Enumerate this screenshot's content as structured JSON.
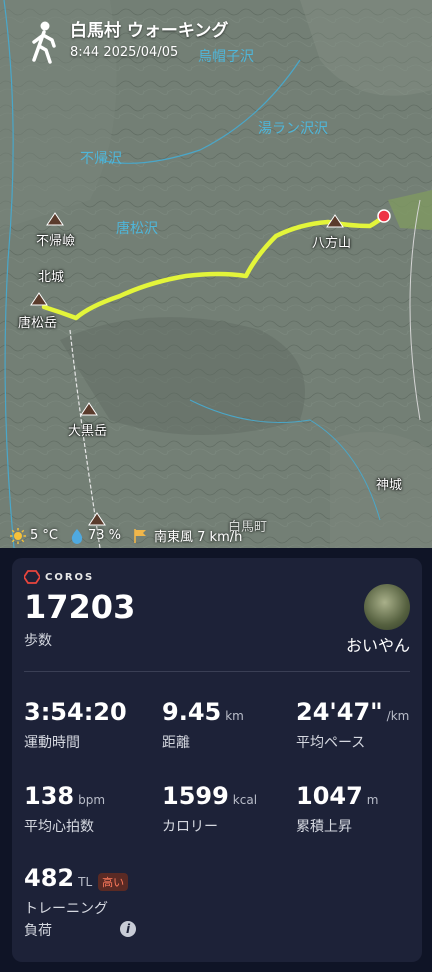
{
  "header": {
    "title": "白馬村 ウォーキング",
    "subtitle": "8:44 2025/04/05",
    "icon": "walking-person-icon"
  },
  "map": {
    "rivers": [
      "烏帽子沢",
      "不帰沢",
      "唐松沢",
      "湯ラン沢沢"
    ],
    "peaks": [
      "不帰嶮",
      "唐松岳",
      "大黒岳",
      "八方山"
    ],
    "places": [
      "北城",
      "神城",
      "白馬町"
    ],
    "route_color": "#e3f53a",
    "end_marker_color": "#ee3344"
  },
  "weather": {
    "temp": "5 °C",
    "humidity": "73 %",
    "wind": "南東風 7 km/h"
  },
  "card": {
    "brand": "COROS",
    "steps": {
      "value": "17203",
      "label": "歩数"
    },
    "user": {
      "name": "おいやん"
    },
    "stats": [
      {
        "value": "3:54:20",
        "unit": "",
        "label": "運動時間"
      },
      {
        "value": "9.45",
        "unit": "km",
        "label": "距離"
      },
      {
        "value": "24'47\"",
        "unit": "/km",
        "label": "平均ペース"
      },
      {
        "value": "138",
        "unit": "bpm",
        "label": "平均心拍数"
      },
      {
        "value": "1599",
        "unit": "kcal",
        "label": "カロリー"
      },
      {
        "value": "1047",
        "unit": "m",
        "label": "累積上昇"
      }
    ],
    "load": {
      "value": "482",
      "unit": "TL",
      "badge": "高い",
      "label1": "トレーニング",
      "label2": "負荷"
    }
  }
}
